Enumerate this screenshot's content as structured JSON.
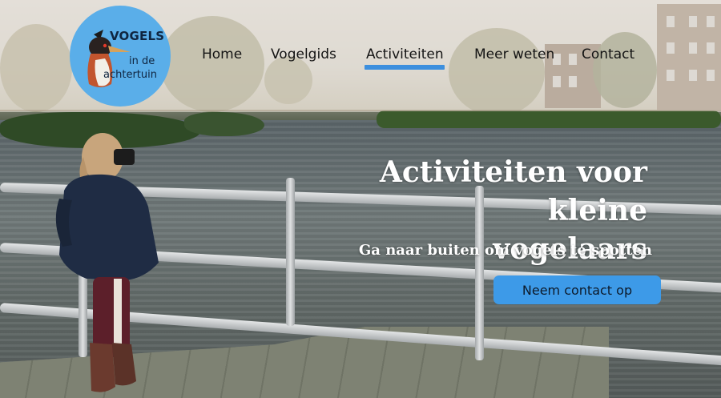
{
  "logo": {
    "line1": "VOGELS",
    "line2": "in de",
    "line3": "achtertuin"
  },
  "nav": {
    "home": "Home",
    "vogelgids": "Vogelgids",
    "activiteiten": "Activiteiten",
    "meer_weten": "Meer weten",
    "contact": "Contact",
    "active": "Activiteiten"
  },
  "hero": {
    "title_line1": "Activiteiten voor kleine",
    "title_line2": "vogelaars",
    "subtitle": "Ga naar buiten om vogels te spotten",
    "cta_label": "Neem contact op"
  },
  "colors": {
    "accent": "#3d8fde",
    "logo_bg": "#5aaee9",
    "header_tint": "#ece2d4"
  }
}
